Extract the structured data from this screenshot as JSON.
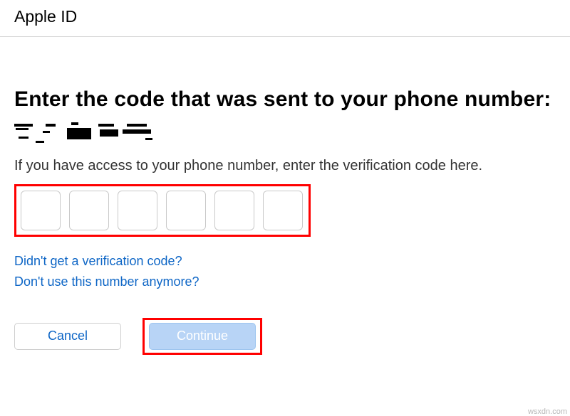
{
  "header": {
    "title": "Apple ID"
  },
  "main": {
    "heading": "Enter the code that was sent to your phone number:",
    "instruction": "If you have access to your phone number, enter the verification code here.",
    "code_digits": [
      "",
      "",
      "",
      "",
      "",
      ""
    ],
    "links": {
      "no_code": "Didn't get a verification code?",
      "no_number": "Don't use this number anymore?"
    },
    "buttons": {
      "cancel": "Cancel",
      "continue": "Continue"
    }
  },
  "watermark": "wsxdn.com"
}
